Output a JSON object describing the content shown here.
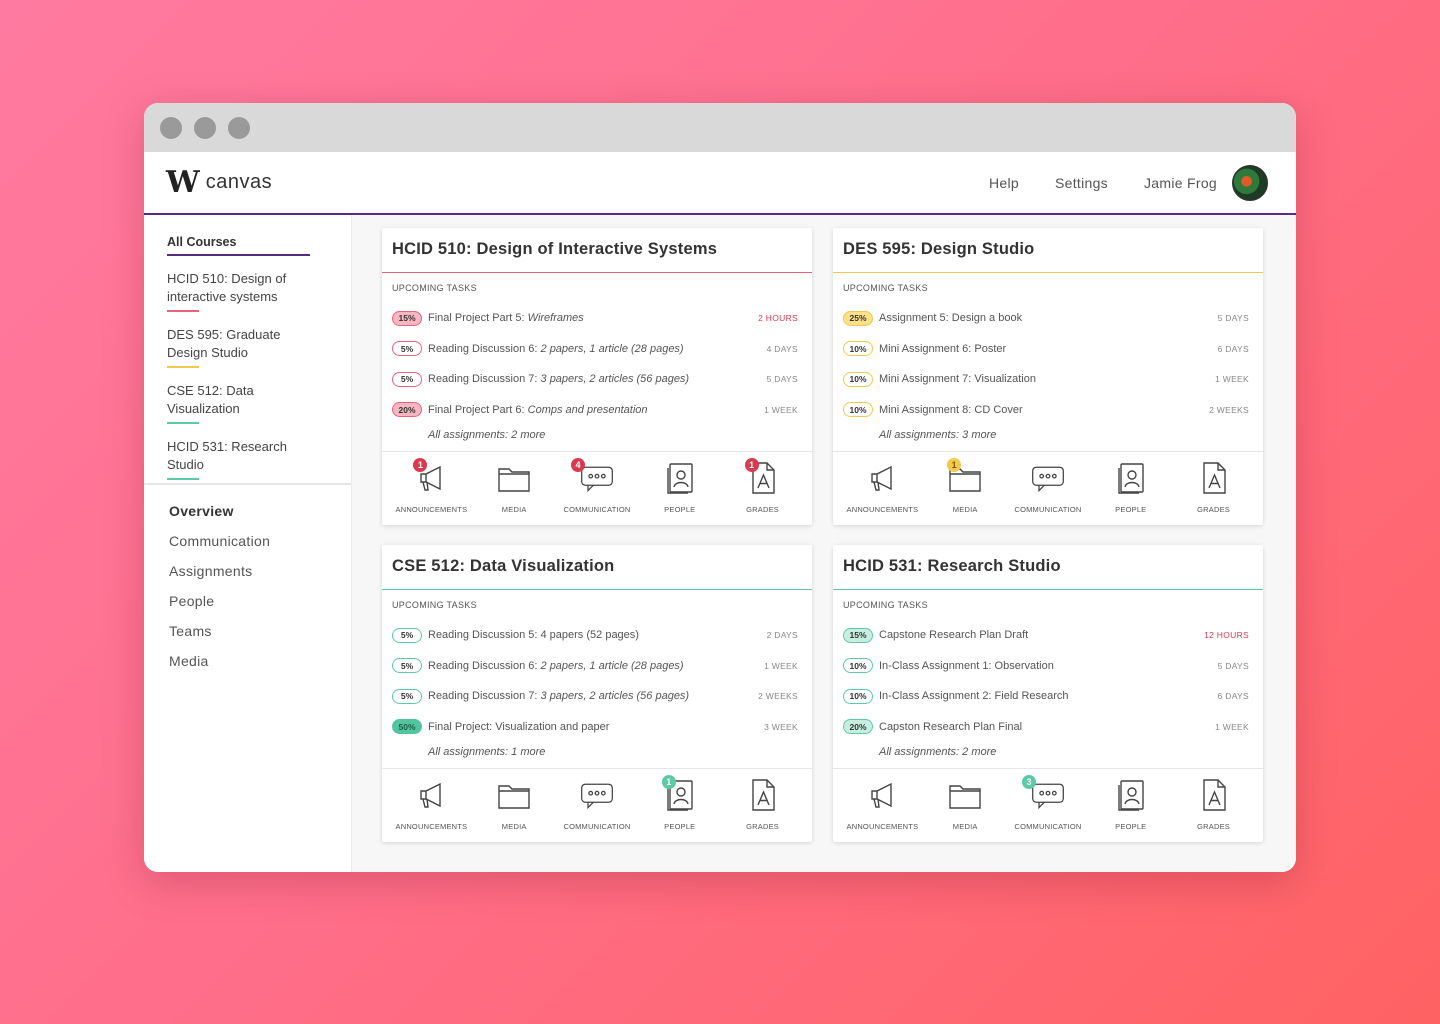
{
  "app": {
    "logo_mark": "W",
    "name": "canvas"
  },
  "header": {
    "help": "Help",
    "settings": "Settings",
    "user_name": "Jamie Frog"
  },
  "sidebar": {
    "all_courses": "All Courses",
    "courses": [
      {
        "label": "HCID 510: Design of interactive systems",
        "color": "#e8627a"
      },
      {
        "label": "DES 595: Graduate Design Studio",
        "color": "#f2c94c"
      },
      {
        "label": "CSE 512: Data Visualization",
        "color": "#5cc9a7"
      },
      {
        "label": "HCID 531: Research Studio",
        "color": "#5cc9a7"
      }
    ],
    "nav": [
      "Overview",
      "Communication",
      "Assignments",
      "People",
      "Teams",
      "Media"
    ]
  },
  "upcoming_label": "UPCOMING TASKS",
  "icon_labels": {
    "announcements": "ANNOUNCEMENTS",
    "media": "MEDIA",
    "communication": "COMMUNICATION",
    "people": "PEOPLE",
    "grades": "GRADES"
  },
  "colors": {
    "pink": "#e8627a",
    "pink_fill": "#f9d6dd",
    "yellow": "#f2c94c",
    "yellow_fill": "#fbe9a8",
    "green": "#5cc9a7",
    "green_fill": "#d5f2e8",
    "green_strong": "#53c59e",
    "accent_purple": "#5a2a82"
  },
  "cards": [
    {
      "title": "HCID 510: Design of Interactive Systems",
      "tasks": [
        {
          "pct": "15%",
          "name": "Final Project Part 5: ",
          "italic": "Wireframes",
          "due": "2 HOURS",
          "urgent": true,
          "pill": "pink_strong"
        },
        {
          "pct": "5%",
          "name": "Reading Discussion 6: ",
          "italic": "2 papers, 1 article (28 pages)",
          "due": "4 DAYS",
          "urgent": false,
          "pill": "pink"
        },
        {
          "pct": "5%",
          "name": "Reading Discussion 7: ",
          "italic": "3 papers, 2 articles (56 pages)",
          "due": "5 DAYS",
          "urgent": false,
          "pill": "pink"
        },
        {
          "pct": "20%",
          "name": "Final Project Part 6: ",
          "italic": "Comps and presentation",
          "due": "1 WEEK",
          "urgent": false,
          "pill": "pink_strong"
        }
      ],
      "more": "All assignments: 2 more",
      "badges": {
        "announcements": "1",
        "communication": "4",
        "grades": "1"
      }
    },
    {
      "title": "DES 595: Design Studio",
      "tasks": [
        {
          "pct": "25%",
          "name": "Assignment 5: Design a book",
          "italic": "",
          "due": "5 DAYS",
          "urgent": false,
          "pill": "yellow_strong"
        },
        {
          "pct": "10%",
          "name": "Mini Assignment 6: Poster",
          "italic": "",
          "due": "6 DAYS",
          "urgent": false,
          "pill": "yellow"
        },
        {
          "pct": "10%",
          "name": "Mini Assignment 7: Visualization",
          "italic": "",
          "due": "1 WEEK",
          "urgent": false,
          "pill": "yellow"
        },
        {
          "pct": "10%",
          "name": "Mini Assignment 8: CD Cover",
          "italic": "",
          "due": "2 WEEKS",
          "urgent": false,
          "pill": "yellow"
        }
      ],
      "more": "All assignments: 3 more",
      "badges": {
        "media": "1"
      }
    },
    {
      "title": "CSE 512: Data Visualization",
      "tasks": [
        {
          "pct": "5%",
          "name": "Reading Discussion 5: 4 papers (52 pages)",
          "italic": "",
          "due": "2 DAYS",
          "urgent": false,
          "pill": "green"
        },
        {
          "pct": "5%",
          "name": "Reading Discussion 6: ",
          "italic": "2 papers, 1 article (28 pages)",
          "due": "1 WEEK",
          "urgent": false,
          "pill": "green"
        },
        {
          "pct": "5%",
          "name": "Reading Discussion 7: ",
          "italic": "3 papers, 2 articles (56 pages)",
          "due": "2 WEEKS",
          "urgent": false,
          "pill": "green"
        },
        {
          "pct": "50%",
          "name": "Final Project: Visualization and paper",
          "italic": "",
          "due": "3 WEEK",
          "urgent": false,
          "pill": "green_strong"
        }
      ],
      "more": "All assignments: 1 more",
      "badges": {
        "people": "1"
      }
    },
    {
      "title": "HCID 531: Research Studio",
      "tasks": [
        {
          "pct": "15%",
          "name": "Capstone Research Plan Draft",
          "italic": "",
          "due": "12 HOURS",
          "urgent": true,
          "pill": "green_mid"
        },
        {
          "pct": "10%",
          "name": "In-Class Assignment 1: Observation",
          "italic": "",
          "due": "5 DAYS",
          "urgent": false,
          "pill": "green"
        },
        {
          "pct": "10%",
          "name": "In-Class Assignment 2: Field Research",
          "italic": "",
          "due": "6 DAYS",
          "urgent": false,
          "pill": "green"
        },
        {
          "pct": "20%",
          "name": "Capston Research Plan Final",
          "italic": "",
          "due": "1 WEEK",
          "urgent": false,
          "pill": "green_mid"
        }
      ],
      "more": "All assignments: 2 more",
      "badges": {
        "communication": "3"
      }
    }
  ]
}
